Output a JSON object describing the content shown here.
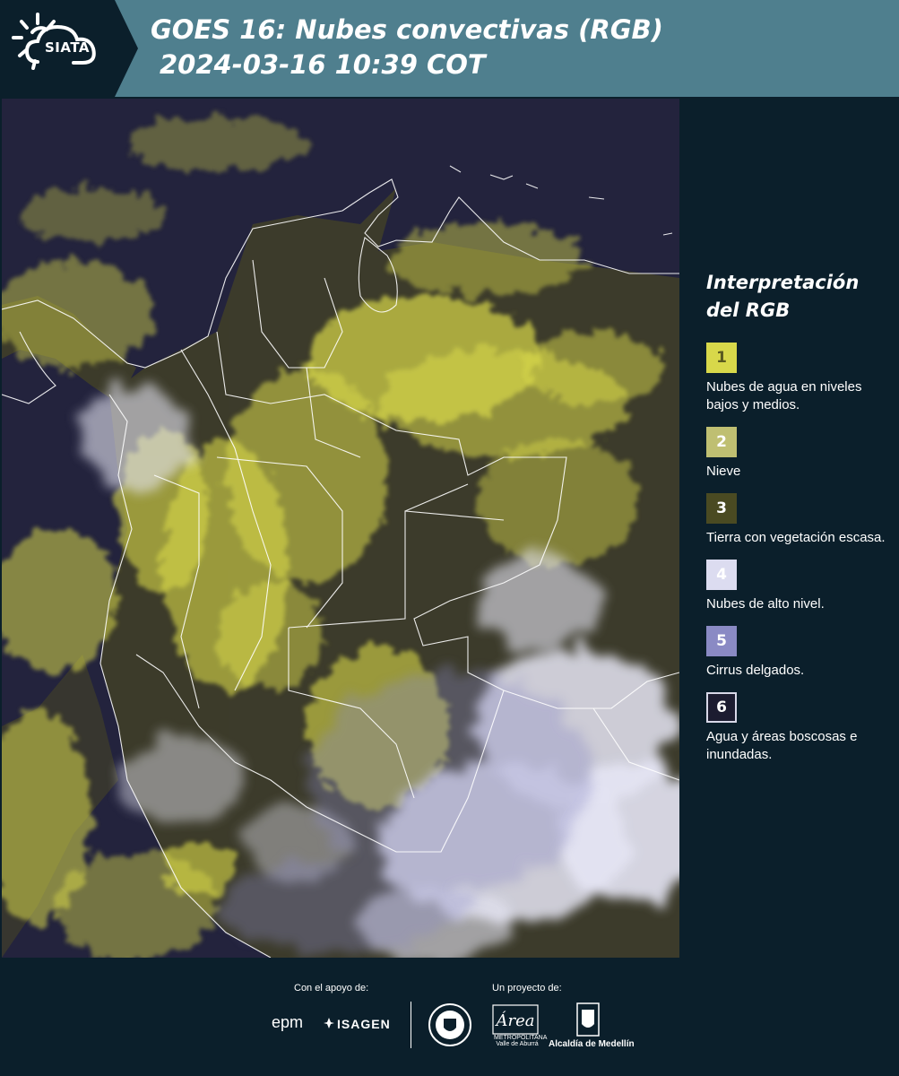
{
  "header": {
    "logo_text": "SIATA",
    "title": "GOES 16: Nubes convectivas (RGB)",
    "datetime": " 2024-03-16 10:39 COT"
  },
  "map": {
    "description_colors": {
      "background": "#23233d",
      "low_clouds": "#d8d84a",
      "high_clouds": "#e4e4f2",
      "land": "#4a4a2a",
      "borders": "#ffffff"
    }
  },
  "legend": {
    "title": "Interpretación del RGB",
    "items": [
      {
        "number": "1",
        "label": "Nubes de agua en niveles bajos y medios.",
        "color": "#d8d84a",
        "text_color": "#5a5a20",
        "border": "none"
      },
      {
        "number": "2",
        "label": "Nieve",
        "color": "#bfbf72",
        "text_color": "#ffffff",
        "border": "none"
      },
      {
        "number": "3",
        "label": "Tierra con vegetación escasa.",
        "color": "#4a4a22",
        "text_color": "#ffffff",
        "border": "none"
      },
      {
        "number": "4",
        "label": "Nubes de alto nivel.",
        "color": "#dcdcf0",
        "text_color": "#ffffff",
        "border": "none"
      },
      {
        "number": "5",
        "label": "Cirrus delgados.",
        "color": "#8a8ac4",
        "text_color": "#ffffff",
        "border": "none"
      },
      {
        "number": "6",
        "label": "Agua y áreas boscosas e inundadas.",
        "color": "#1c1c30",
        "text_color": "#ffffff",
        "border": "#d8d8e8"
      }
    ]
  },
  "footer": {
    "support_label": "Con el apoyo de:",
    "project_label": "Un proyecto de:",
    "epm": "epm",
    "isagen": "ISAGEN",
    "area_script": "Área",
    "area_subtext": "METROPOLITANA Valle de Aburrá",
    "alcaldia": "Alcaldía de Medellín"
  }
}
